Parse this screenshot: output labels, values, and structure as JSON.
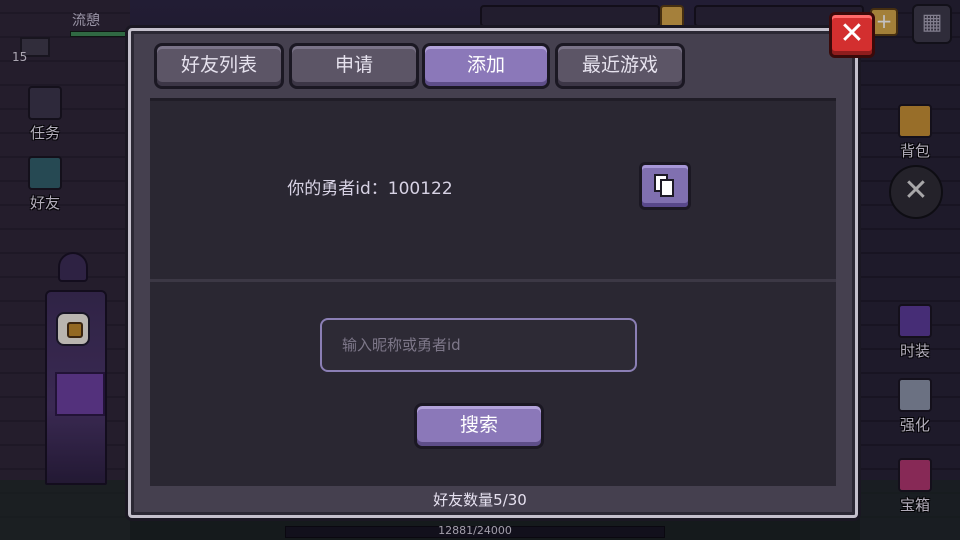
{
  "hud": {
    "player_name": "流憩",
    "level": "15",
    "coins": "",
    "gems": ""
  },
  "left_menu": {
    "task_label": "任务",
    "friends_label": "好友"
  },
  "right_menu": {
    "bag_label": "背包",
    "fashion_label": "时装",
    "strengthen_label": "强化",
    "chest_label": "宝箱"
  },
  "xp": {
    "text": "12881/24000",
    "progress": 0.537
  },
  "modal": {
    "tabs": [
      {
        "label": "好友列表",
        "active": false
      },
      {
        "label": "申请",
        "active": false
      },
      {
        "label": "添加",
        "active": true
      },
      {
        "label": "最近游戏",
        "active": false
      }
    ],
    "hero_id_text": "你的勇者id：100122",
    "search_placeholder": "输入昵称或勇者id",
    "search_value": "",
    "search_button": "搜索",
    "friend_count": "好友数量5/30",
    "close_symbol": "✕"
  },
  "icons": {
    "copy": "copy-icon",
    "close": "close-icon",
    "task": "exclamation-icon",
    "friends": "friend-icon",
    "bag": "backpack-icon",
    "fashion": "robe-icon",
    "strengthen": "hammer-icon",
    "chest": "treasure-chest-icon",
    "settings": "grid-icon"
  },
  "colors": {
    "accent": "#8b78b9",
    "close": "#d32f2f",
    "panel": "#45404f",
    "content": "#2a2732"
  }
}
